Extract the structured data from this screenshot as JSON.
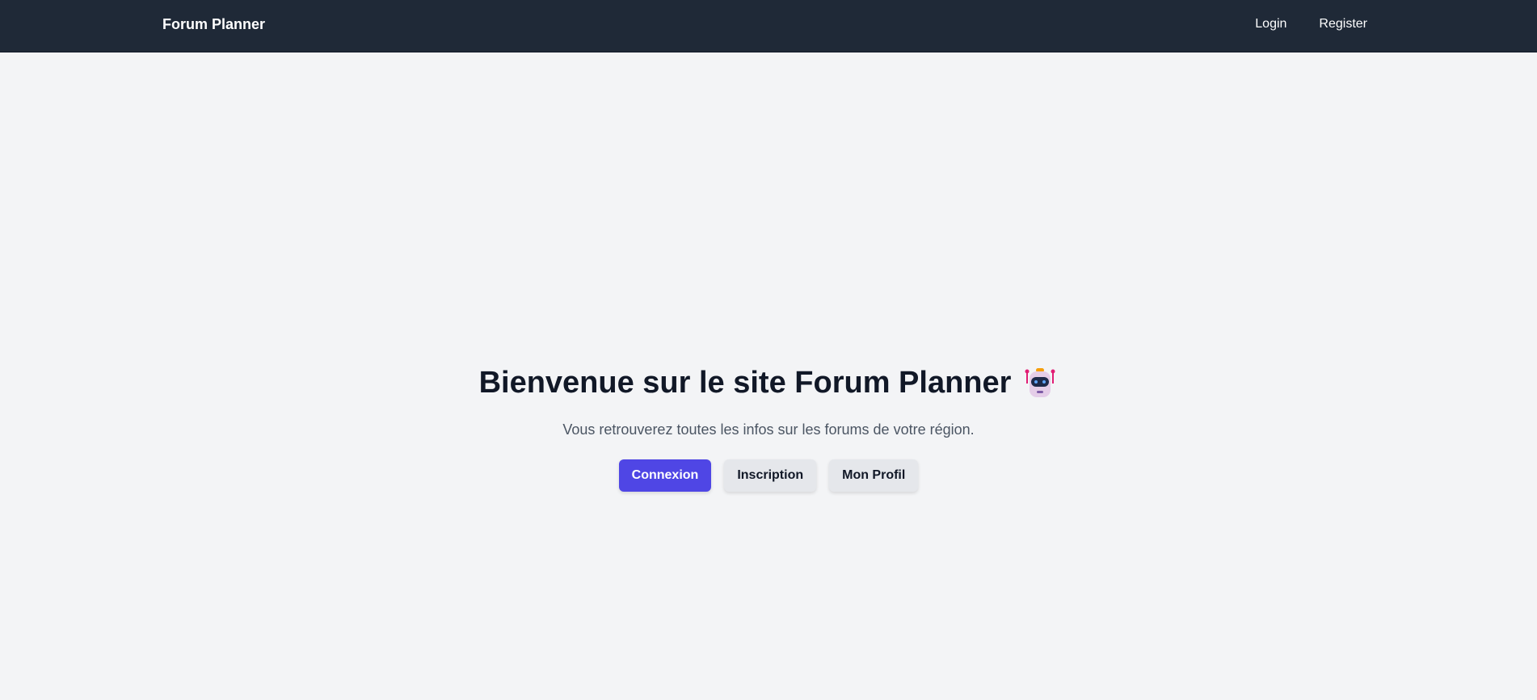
{
  "navbar": {
    "brand": "Forum Planner",
    "links": [
      "Login",
      "Register"
    ]
  },
  "hero": {
    "title": "Bienvenue sur le site Forum Planner",
    "title_icon": "robot-icon",
    "subtitle": "Vous retrouverez toutes les infos sur les forums de votre région.",
    "buttons": {
      "login": "Connexion",
      "register": "Inscription",
      "profile": "Mon Profil"
    }
  },
  "colors": {
    "navbar_bg": "#1f2937",
    "page_bg": "#f3f4f6",
    "primary": "#4f46e5",
    "secondary": "#e5e7eb",
    "title_text": "#111827",
    "subtitle_text": "#4b5563"
  }
}
